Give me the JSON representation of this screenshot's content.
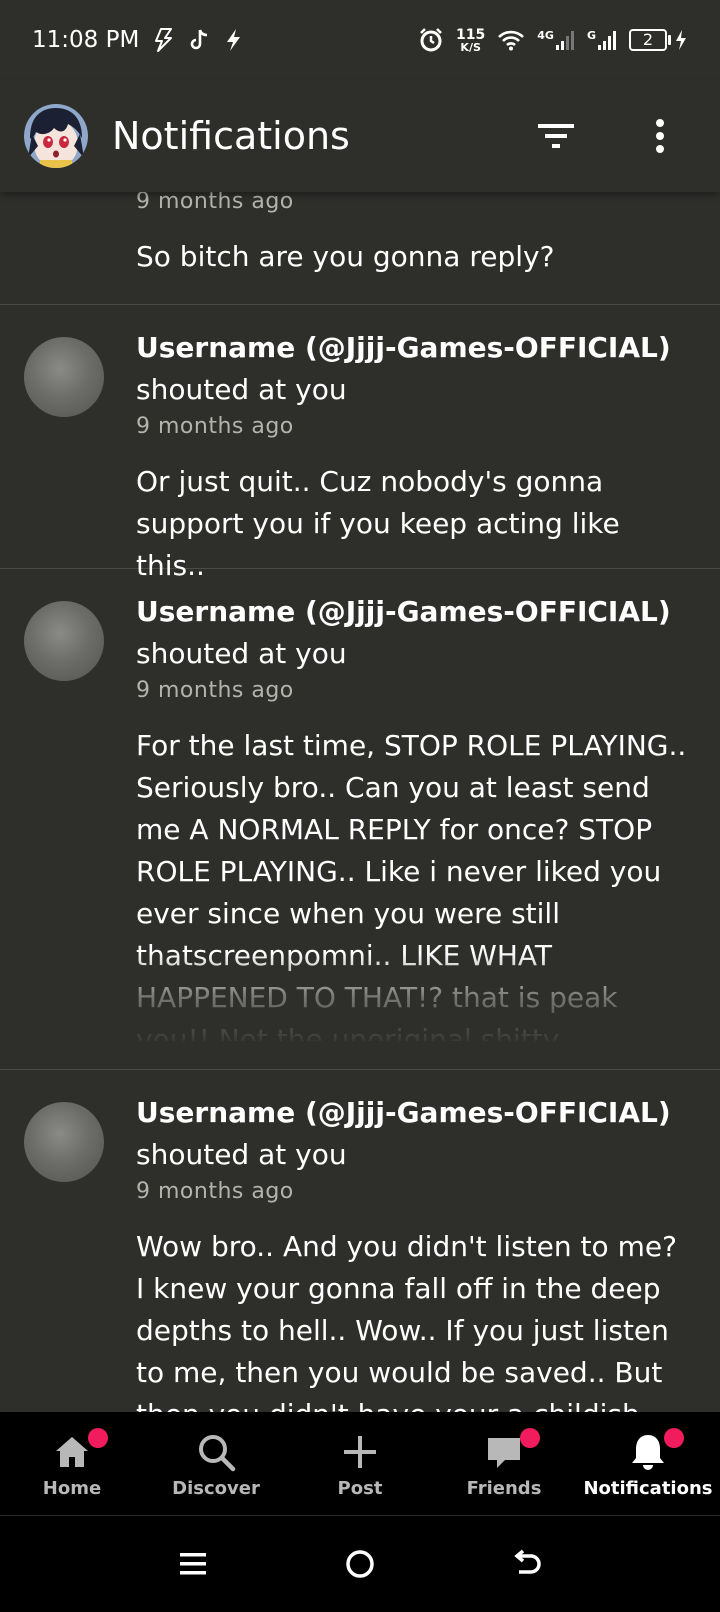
{
  "status_bar": {
    "time": "11:08 PM",
    "speed_value": "115",
    "speed_unit": "K/S",
    "network_1": "4G",
    "network_2": "G",
    "battery": "2"
  },
  "header": {
    "title": "Notifications"
  },
  "notifications": [
    {
      "time": "9 months ago",
      "message": "So bitch are you gonna reply?"
    },
    {
      "username": "Username (@Jjjj-Games-OFFICIAL)",
      "action": "shouted at you",
      "time": "9 months ago",
      "message": "Or just quit.. Cuz nobody's gonna support you if you keep acting like this.."
    },
    {
      "username": "Username (@Jjjj-Games-OFFICIAL)",
      "action": "shouted at you",
      "time": "9 months ago",
      "message": "For the last time, STOP ROLE PLAYING.. Seriously bro.. Can you at least send me A NORMAL REPLY for once? STOP ROLE PLAYING.. Like i never liked you ever since when you were still thatscreenpomni.. LIKE WHAT HAPPENED TO THAT!? that is peak you!! Not the unoriginal shitty undertale"
    },
    {
      "username": "Username (@Jjjj-Games-OFFICIAL)",
      "action": "shouted at you",
      "time": "9 months ago",
      "message": "Wow bro.. And you didn't listen to me? I knew your gonna fall off in the deep depths to hell.. Wow.. If you just listen to me, then you would be saved.. But then you didn't have your a childish"
    }
  ],
  "bottom_nav": [
    {
      "label": "Home",
      "icon": "home-icon",
      "badge": true
    },
    {
      "label": "Discover",
      "icon": "search-icon",
      "badge": false
    },
    {
      "label": "Post",
      "icon": "plus-icon",
      "badge": false
    },
    {
      "label": "Friends",
      "icon": "chat-icon",
      "badge": true
    },
    {
      "label": "Notifications",
      "icon": "bell-icon",
      "badge": true,
      "active": true
    }
  ],
  "colors": {
    "background": "#2e2e2b",
    "nav_background": "#000000",
    "badge": "#f01c5c",
    "divider": "#4a4a46",
    "timestamp": "#b3b3ae"
  }
}
